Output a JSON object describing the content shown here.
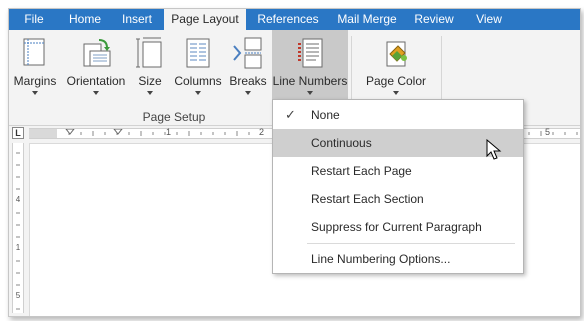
{
  "tabs": [
    {
      "label": "File"
    },
    {
      "label": "Home"
    },
    {
      "label": "Insert"
    },
    {
      "label": "Page Layout"
    },
    {
      "label": "References"
    },
    {
      "label": "Mail Merge"
    },
    {
      "label": "Review"
    },
    {
      "label": "View"
    }
  ],
  "ribbon": {
    "buttons": [
      {
        "label": "Margins",
        "icon": "margins-icon"
      },
      {
        "label": "Orientation",
        "icon": "orientation-icon"
      },
      {
        "label": "Size",
        "icon": "size-icon"
      },
      {
        "label": "Columns",
        "icon": "columns-icon"
      },
      {
        "label": "Breaks",
        "icon": "breaks-icon"
      },
      {
        "label": "Line Numbers",
        "icon": "line-numbers-icon"
      },
      {
        "label": "Page Color",
        "icon": "page-color-icon"
      }
    ],
    "groups": [
      {
        "caption": "Page Setup"
      }
    ]
  },
  "ruler": {
    "tab_selector": "L",
    "h_numbers": [
      "1",
      "2",
      "5"
    ],
    "v_numbers": [
      "4",
      "1",
      "5"
    ]
  },
  "menu": {
    "items": [
      {
        "label": "None",
        "checked": true
      },
      {
        "label": "Continuous",
        "highlighted": true
      },
      {
        "label": "Restart Each Page"
      },
      {
        "label": "Restart Each Section"
      },
      {
        "label": "Suppress for Current Paragraph"
      },
      {
        "label": "Line Numbering Options..."
      }
    ]
  },
  "colors": {
    "tab_bar": "#2a77c5",
    "pressed_button": "#c9c9c9",
    "menu_highlight": "#cfcfcf"
  }
}
